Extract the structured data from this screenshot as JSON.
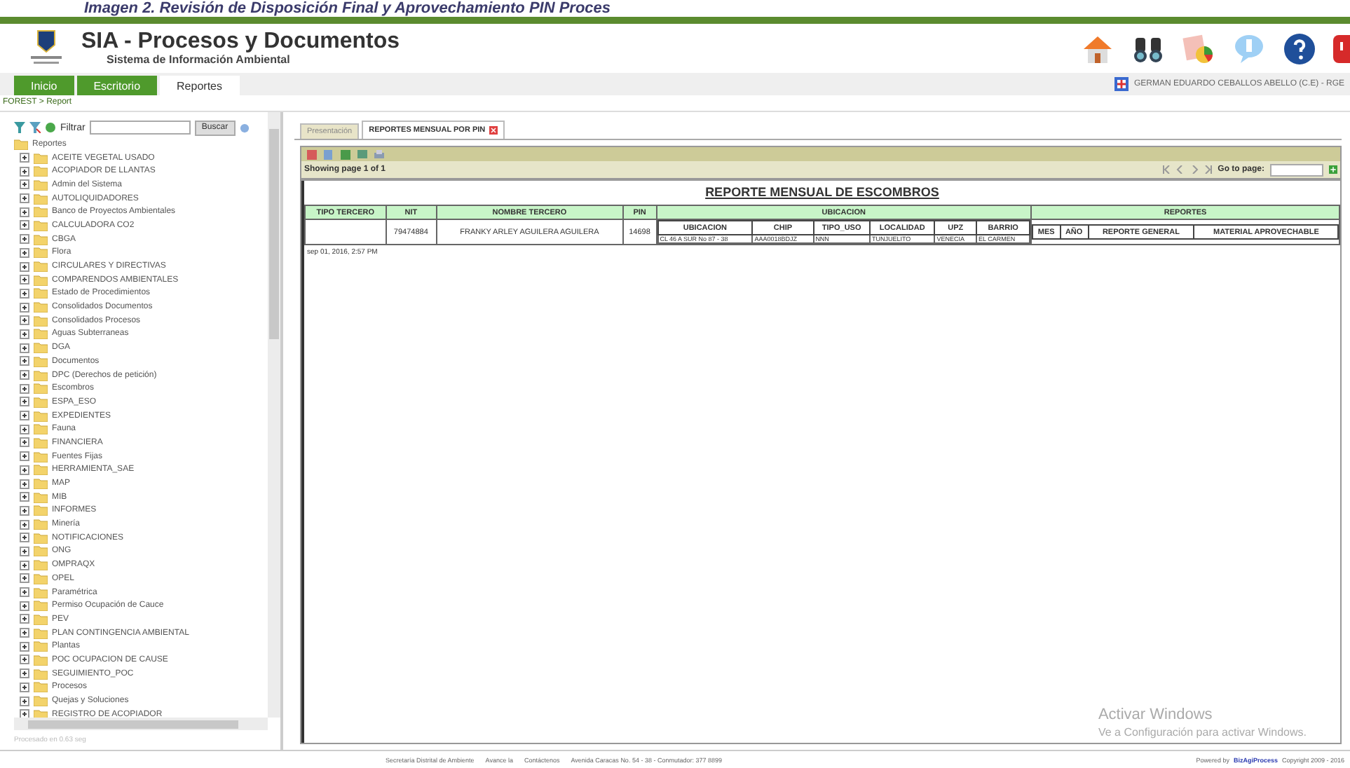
{
  "caption": "Imagen 2. Revisión de Disposición Final y Aprovechamiento PIN Proces",
  "header": {
    "title": "SIA - Procesos y Documentos",
    "subtitle": "Sistema de Información Ambiental"
  },
  "nav_tabs": [
    {
      "label": "Inicio",
      "selected": false
    },
    {
      "label": "Escritorio",
      "selected": false
    },
    {
      "label": "Reportes",
      "selected": true
    }
  ],
  "user": "GERMAN EDUARDO CEBALLOS ABELLO (C.E) - RGE",
  "breadcrumb": "FOREST > Report",
  "sidebar": {
    "filter_label": "Filtrar",
    "search_button": "Buscar",
    "tree": {
      "label": "Reportes",
      "children": [
        {
          "label": "ACEITE VEGETAL USADO",
          "expanded": false
        },
        {
          "label": "ACOPIADOR DE LLANTAS",
          "expanded": false
        },
        {
          "label": "Admin del Sistema",
          "expanded": false
        },
        {
          "label": "AUTOLIQUIDADORES",
          "expanded": false
        },
        {
          "label": "Banco de Proyectos Ambientales",
          "expanded": false
        },
        {
          "label": "CALCULADORA CO2",
          "expanded": false
        },
        {
          "label": "CBGA",
          "expanded": false
        },
        {
          "label": "Flora",
          "expanded": false
        },
        {
          "label": "CIRCULARES Y DIRECTIVAS",
          "expanded": false
        },
        {
          "label": "COMPARENDOS AMBIENTALES",
          "expanded": false
        },
        {
          "label": "Estado de Procedimientos",
          "expanded": false
        },
        {
          "label": "Consolidados Documentos",
          "expanded": false
        },
        {
          "label": "Consolidados Procesos",
          "expanded": false
        },
        {
          "label": "Aguas Subterraneas",
          "expanded": false
        },
        {
          "label": "DGA",
          "expanded": false
        },
        {
          "label": "Documentos",
          "expanded": false
        },
        {
          "label": "DPC (Derechos de petición)",
          "expanded": false
        },
        {
          "label": "Escombros",
          "expanded": false
        },
        {
          "label": "ESPA_ESO",
          "expanded": false
        },
        {
          "label": "EXPEDIENTES",
          "expanded": false
        },
        {
          "label": "Fauna",
          "expanded": false
        },
        {
          "label": "FINANCIERA",
          "expanded": false
        },
        {
          "label": "Fuentes Fijas",
          "expanded": false
        },
        {
          "label": "HERRAMIENTA_SAE",
          "expanded": false
        },
        {
          "label": "MAP",
          "expanded": false
        },
        {
          "label": "MIB",
          "expanded": false
        },
        {
          "label": "INFORMES",
          "expanded": false
        },
        {
          "label": "Minería",
          "expanded": false
        },
        {
          "label": "NOTIFICACIONES",
          "expanded": false
        },
        {
          "label": "ONG",
          "expanded": false
        },
        {
          "label": "OMPRAQX",
          "expanded": false
        },
        {
          "label": "OPEL",
          "expanded": false
        },
        {
          "label": "Paramétrica",
          "expanded": false
        },
        {
          "label": "Permiso Ocupación de Cauce",
          "expanded": false
        },
        {
          "label": "PEV",
          "expanded": false
        },
        {
          "label": "PLAN CONTINGENCIA AMBIENTAL",
          "expanded": false
        },
        {
          "label": "Plantas",
          "expanded": false
        },
        {
          "label": "POC OCUPACION DE CAUSE",
          "expanded": false
        },
        {
          "label": "SEGUIMIENTO_POC",
          "expanded": false
        },
        {
          "label": "Procesos",
          "expanded": false
        },
        {
          "label": "Quejas y Soluciones",
          "expanded": false
        },
        {
          "label": "REGISTRO DE ACOPIADOR",
          "expanded": false
        }
      ]
    }
  },
  "sidebar_footer": "Procesado en 0.63 seg",
  "report_tabs": [
    {
      "label": "Presentación",
      "selected": false,
      "closable": false
    },
    {
      "label": "REPORTES MENSUAL POR PIN",
      "selected": true,
      "closable": true
    }
  ],
  "pager": {
    "status": "Showing page 1 of 1",
    "goto_label": "Go to page:"
  },
  "report": {
    "title": "REPORTE MENSUAL DE ESCOMBROS",
    "columns": [
      "TIPO TERCERO",
      "NIT",
      "NOMBRE TERCERO",
      "PIN"
    ],
    "ubicacion": {
      "label": "UBICACION",
      "sub_columns": [
        "UBICACION",
        "CHIP",
        "TIPO_USO",
        "LOCALIDAD",
        "UPZ",
        "BARRIO"
      ]
    },
    "reportes": {
      "label": "REPORTES",
      "sub_columns": [
        "MES",
        "AÑO",
        "REPORTE GENERAL",
        "MATERIAL APROVECHABLE"
      ]
    },
    "row": {
      "nit": "79474884",
      "nombre": "FRANKY ARLEY AGUILERA AGUILERA",
      "pin": "14698",
      "ubicacion": [
        "CL 46 A SUR No 87 - 38",
        "AAA0018BDJZ",
        "NNN",
        "TUNJUELITO",
        "VENECIA",
        "EL CARMEN"
      ]
    },
    "timestamp": "sep 01, 2016, 2:57 PM"
  },
  "os_notice": {
    "title": "Activar Windows",
    "text": "Ve a Configuración para activar Windows."
  },
  "footer": {
    "links": [
      "Secretaría Distrital de Ambiente",
      "Avance la",
      "Contáctenos",
      "Avenida Caracas No. 54 - 38 - Conmutador: 377 8899"
    ],
    "powered": "Powered by",
    "brand": "BizAgiProcess",
    "copyright": "Copyright 2009 - 2016"
  }
}
